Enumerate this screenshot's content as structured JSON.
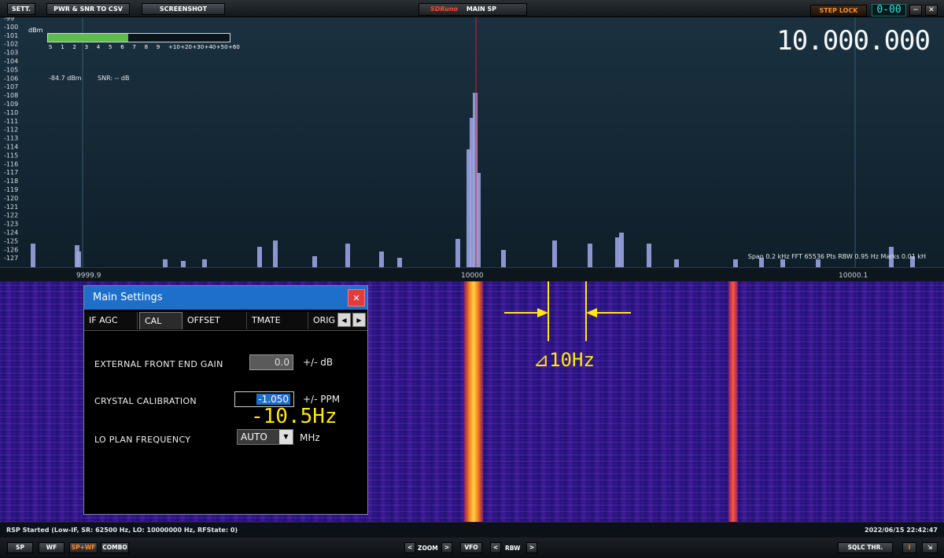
{
  "topbar": {
    "sett_label": "SETT.",
    "csv_label": "PWR & SNR TO CSV",
    "screenshot_label": "SCREENSHOT",
    "brand_logo": "SDRuno",
    "brand_label": "MAIN SP",
    "steplock_label": "STEP LOCK",
    "digits": "0-00",
    "minimize_label": "−",
    "close_label": "✕"
  },
  "spectrum": {
    "frequency_display": "10.000.000",
    "dbm_unit": "dBm",
    "smeter_labels": [
      "S",
      "1",
      "2",
      "3",
      "4",
      "5",
      "6",
      "7",
      "8",
      "9",
      "+10",
      "+20",
      "+30",
      "+40",
      "+50",
      "+60"
    ],
    "smeter_level": 0.44,
    "level_text": "-84.7 dBm",
    "snr_text": "SNR:  -- dB",
    "info_text": "Span 0.2 kHz  FFT 65536 Pts  RBW 0.95 Hz  Marks 0.01 kH",
    "db_scale": [
      "-99",
      "-100",
      "-101",
      "-102",
      "-103",
      "-104",
      "-105",
      "-106",
      "-107",
      "-108",
      "-109",
      "-110",
      "-111",
      "-112",
      "-113",
      "-114",
      "-115",
      "-116",
      "-117",
      "-118",
      "-119",
      "-120",
      "-121",
      "-122",
      "-123",
      "-124",
      "-125",
      "-126",
      "-127"
    ],
    "freq_ticks": [
      "9999.9",
      "10000",
      "10000.1"
    ],
    "colors": {
      "bars": "#9aa3e0",
      "cursor": "#d8202a",
      "grid": "#3a5a70"
    }
  },
  "annotation": {
    "delta": "⊿10Hz",
    "offset": "-10.5Hz"
  },
  "dialog": {
    "title": "Main Settings",
    "close": "✕",
    "tabs": [
      "IF AGC",
      "CAL",
      "OFFSET",
      "TMATE",
      "ORIG"
    ],
    "tab_prev": "◀",
    "tab_next": "▶",
    "ext_gain_label": "EXTERNAL FRONT END GAIN",
    "ext_gain_value": "0.0",
    "ext_gain_unit": "+/-  dB",
    "crystal_label": "CRYSTAL CALIBRATION",
    "crystal_value": "-1.050",
    "crystal_unit": "+/-  PPM",
    "lo_label": "LO PLAN FREQUENCY",
    "lo_value": "AUTO",
    "lo_arrow": "▼",
    "lo_unit": "MHz"
  },
  "status": {
    "left": "RSP Started (Low-IF, SR: 62500 Hz, LO: 10000000 Hz, RFState: 0)",
    "right": "2022/06/15 22:42:47"
  },
  "bottombar": {
    "sp": "SP",
    "wf": "WF",
    "spwf": "SP+WF",
    "combo": "COMBO",
    "zoom_prev": "<",
    "zoom": "ZOOM",
    "zoom_next": ">",
    "vfo": "VFO",
    "rbw_prev": "<",
    "rbw": "RBW",
    "rbw_next": ">",
    "sqlc": "SQLC THR.",
    "info": "i",
    "resize": "⇲"
  }
}
